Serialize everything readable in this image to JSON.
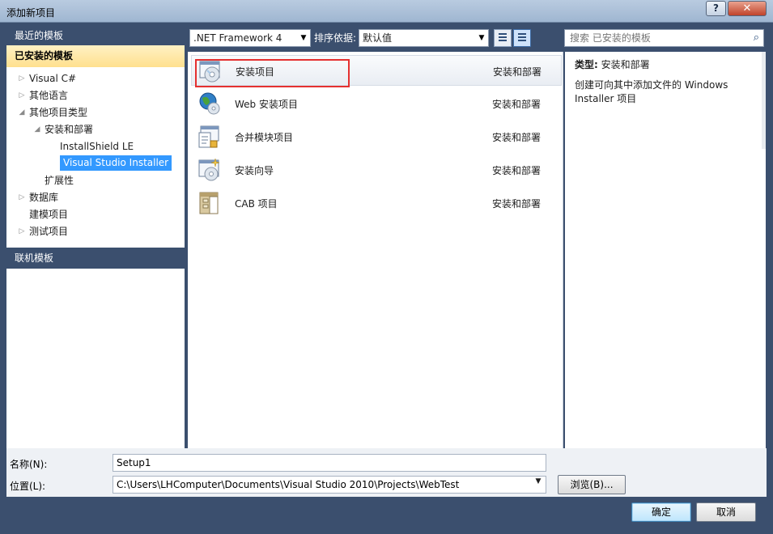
{
  "window": {
    "title": "添加新项目",
    "help": "?",
    "close": "✕"
  },
  "left": {
    "recent_header": "最近的模板",
    "installed_header": "已安装的模板",
    "tree": [
      {
        "label": "Visual C#",
        "level": 0,
        "arrow": "▷"
      },
      {
        "label": "其他语言",
        "level": 0,
        "arrow": "▷"
      },
      {
        "label": "其他项目类型",
        "level": 0,
        "arrow": "◢"
      },
      {
        "label": "安装和部署",
        "level": 1,
        "arrow": "◢"
      },
      {
        "label": "InstallShield LE",
        "level": 2,
        "arrow": ""
      },
      {
        "label": "Visual Studio Installer",
        "level": 2,
        "arrow": "",
        "selected": true
      },
      {
        "label": "扩展性",
        "level": 1,
        "arrow": ""
      },
      {
        "label": "数据库",
        "level": 0,
        "arrow": "▷"
      },
      {
        "label": "建模项目",
        "level": 0,
        "arrow": ""
      },
      {
        "label": "测试项目",
        "level": 0,
        "arrow": "▷"
      }
    ],
    "online_header": "联机模板"
  },
  "toolbar": {
    "framework": ".NET Framework 4",
    "sort_label": "排序依据:",
    "sort_value": "默认值",
    "search_placeholder": "搜索 已安装的模板"
  },
  "templates": [
    {
      "name": "安装项目",
      "category": "安装和部署",
      "icon": "setup-project-icon",
      "selected": true
    },
    {
      "name": "Web 安装项目",
      "category": "安装和部署",
      "icon": "web-setup-icon"
    },
    {
      "name": "合并模块项目",
      "category": "安装和部署",
      "icon": "merge-module-icon"
    },
    {
      "name": "安装向导",
      "category": "安装和部署",
      "icon": "setup-wizard-icon"
    },
    {
      "name": "CAB 项目",
      "category": "安装和部署",
      "icon": "cab-project-icon"
    }
  ],
  "details": {
    "type_label": "类型:",
    "type_value": "安装和部署",
    "description": "创建可向其中添加文件的 Windows Installer 项目"
  },
  "form": {
    "name_label": "名称(N):",
    "name_value": "Setup1",
    "location_label": "位置(L):",
    "location_value": "C:\\Users\\LHComputer\\Documents\\Visual Studio 2010\\Projects\\WebTest",
    "browse": "浏览(B)..."
  },
  "buttons": {
    "ok": "确定",
    "cancel": "取消"
  },
  "colors": {
    "selection": "#3399ff",
    "installed_bg": "#ffe08e",
    "frame": "#3b4f6e",
    "highlight_box": "#e53030"
  }
}
